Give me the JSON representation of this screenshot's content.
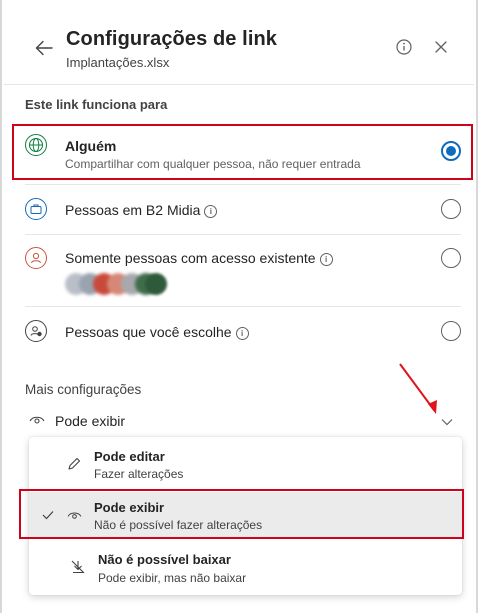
{
  "header": {
    "title": "Configurações de link",
    "file_name": "Implantações.xlsx"
  },
  "link_works_for": {
    "heading": "Este link funciona para",
    "options": [
      {
        "label": "Alguém",
        "description": "Compartilhar com qualquer pessoa, não requer entrada",
        "selected": true,
        "icon": "globe-icon"
      },
      {
        "label": "Pessoas em B2 Midia",
        "description": "",
        "selected": false,
        "icon": "briefcase-icon",
        "has_info": true
      },
      {
        "label": "Somente pessoas com acesso existente",
        "description": "",
        "selected": false,
        "icon": "person-icon",
        "has_info": true
      },
      {
        "label": "Pessoas que você escolhe",
        "description": "",
        "selected": false,
        "icon": "people-icon",
        "has_info": true
      }
    ]
  },
  "more_settings": {
    "heading": "Mais configurações",
    "permission_value": "Pode exibir",
    "menu": [
      {
        "label": "Pode editar",
        "description": "Fazer alterações",
        "icon": "pencil-icon",
        "selected": false
      },
      {
        "label": "Pode exibir",
        "description": "Não é possível fazer alterações",
        "icon": "eye-icon",
        "selected": true
      },
      {
        "label": "Não é possível baixar",
        "description": "Pode exibir, mas não baixar",
        "icon": "no-download-icon",
        "selected": false
      }
    ]
  },
  "colors": {
    "accent": "#0f6cbd",
    "highlight": "#d0021b",
    "selected_row": "#ebebeb"
  }
}
